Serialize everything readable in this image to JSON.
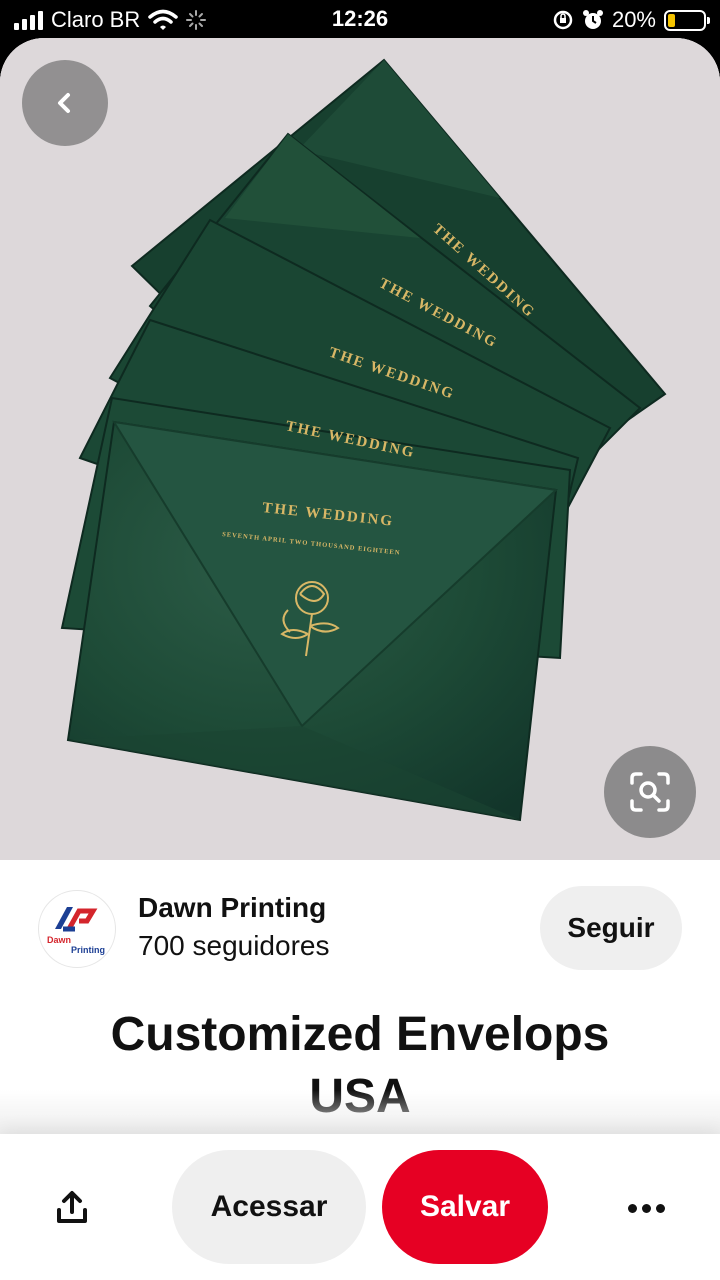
{
  "status_bar": {
    "carrier": "Claro BR",
    "time": "12:26",
    "battery_percent": "20%",
    "battery_level": 0.2,
    "icons": [
      "signal-icon",
      "wifi-icon",
      "loading-icon",
      "screen-rotation-lock-icon",
      "alarm-icon",
      "battery-icon"
    ]
  },
  "pin": {
    "image_envelope_texts": {
      "heading": "THE WEDDING",
      "subheading": "SEVENTH APRIL TWO THOUSAND EIGHTEEN"
    },
    "back_icon": "chevron-left-icon",
    "visual_search_icon": "visual-search-icon"
  },
  "creator": {
    "name": "Dawn Printing",
    "followers": "700 seguidores",
    "logo_text": "Dawn Printing",
    "follow_label": "Seguir"
  },
  "title": "Customized Envelops USA",
  "actions": {
    "share_icon": "share-icon",
    "visit_label": "Acessar",
    "save_label": "Salvar",
    "more_icon": "more-icon"
  },
  "colors": {
    "save_red": "#e60023",
    "envelope_green": "#1d4a36",
    "gold_foil": "#d8b766",
    "battery_yellow": "#f5c400"
  }
}
